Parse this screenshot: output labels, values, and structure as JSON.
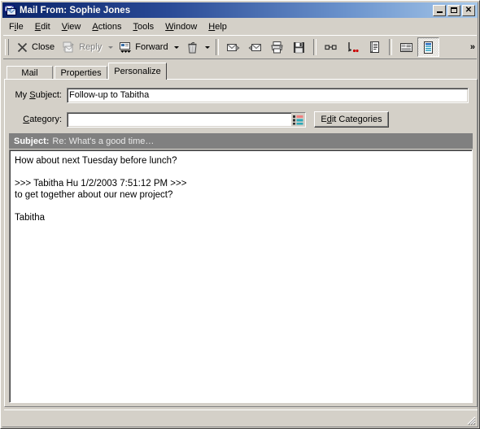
{
  "window": {
    "title": "Mail From: Sophie Jones",
    "icon": "mail-stack-icon",
    "controls": {
      "minimize": "_",
      "maximize": "□",
      "close": "✕"
    }
  },
  "menubar": {
    "items": [
      {
        "name": "file",
        "pre": "F",
        "accel": "i",
        "post": "le"
      },
      {
        "name": "edit",
        "pre": "",
        "accel": "E",
        "post": "dit"
      },
      {
        "name": "view",
        "pre": "",
        "accel": "V",
        "post": "iew"
      },
      {
        "name": "actions",
        "pre": "",
        "accel": "A",
        "post": "ctions"
      },
      {
        "name": "tools",
        "pre": "",
        "accel": "T",
        "post": "ools"
      },
      {
        "name": "window",
        "pre": "",
        "accel": "W",
        "post": "indow"
      },
      {
        "name": "help",
        "pre": "",
        "accel": "H",
        "post": "elp"
      }
    ]
  },
  "toolbar": {
    "close_label": "Close",
    "reply_label": "Reply",
    "forward_label": "Forward",
    "overflow": "»",
    "icons": {
      "close": "x-close-icon",
      "reply": "reply-icon",
      "forward": "forward-icon",
      "delete": "trash-icon",
      "next": "next-message-icon",
      "previous": "previous-message-icon",
      "print": "printer-icon",
      "save": "floppy-save-icon",
      "mark_read": "glasses-read-icon",
      "route": "route-arrow-icon",
      "document": "document-properties-icon",
      "properties": "properties-panel-icon",
      "personalize": "personalize-icon"
    }
  },
  "tabs": [
    {
      "label": "Mail",
      "active": false
    },
    {
      "label": "Properties",
      "active": false
    },
    {
      "label": "Personalize",
      "active": true
    }
  ],
  "form": {
    "subject": {
      "label_pre": "My ",
      "label_accel": "S",
      "label_post": "ubject:",
      "value": "Follow-up to Tabitha",
      "placeholder": ""
    },
    "category": {
      "label_pre": "",
      "label_accel": "C",
      "label_post": "ategory:",
      "value": "",
      "placeholder": "",
      "picker_icon": "category-list-icon"
    },
    "edit_categories": {
      "pre": "E",
      "accel": "d",
      "post": "it Categories"
    }
  },
  "message": {
    "subject_label": "Subject:",
    "subject_value": "Re: What's a good time…",
    "body_lines": [
      "How about next Tuesday before lunch?",
      "",
      ">>> Tabitha Hu 1/2/2003 7:51:12 PM >>>",
      "to get together about our new project?",
      "",
      "Tabitha"
    ]
  },
  "statusbar": {
    "text": "",
    "grip": "resize-grip-icon"
  },
  "colors": {
    "title_start": "#0a246a",
    "title_end": "#a6c8ea",
    "face": "#d4d0c8",
    "subject_band": "#808080",
    "text": "#000000",
    "disabled_text": "#808080",
    "field_bg": "#ffffff"
  }
}
